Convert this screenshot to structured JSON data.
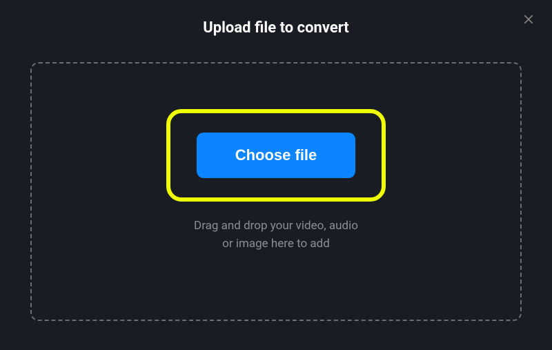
{
  "dialog": {
    "title": "Upload file to convert",
    "close_label": "Close"
  },
  "dropzone": {
    "choose_file_label": "Choose file",
    "hint_line1": "Drag and drop your video, audio",
    "hint_line2": "or image here to add"
  },
  "colors": {
    "accent": "#0a84ff",
    "highlight": "#f0ff00",
    "bg": "#1a1c23"
  }
}
